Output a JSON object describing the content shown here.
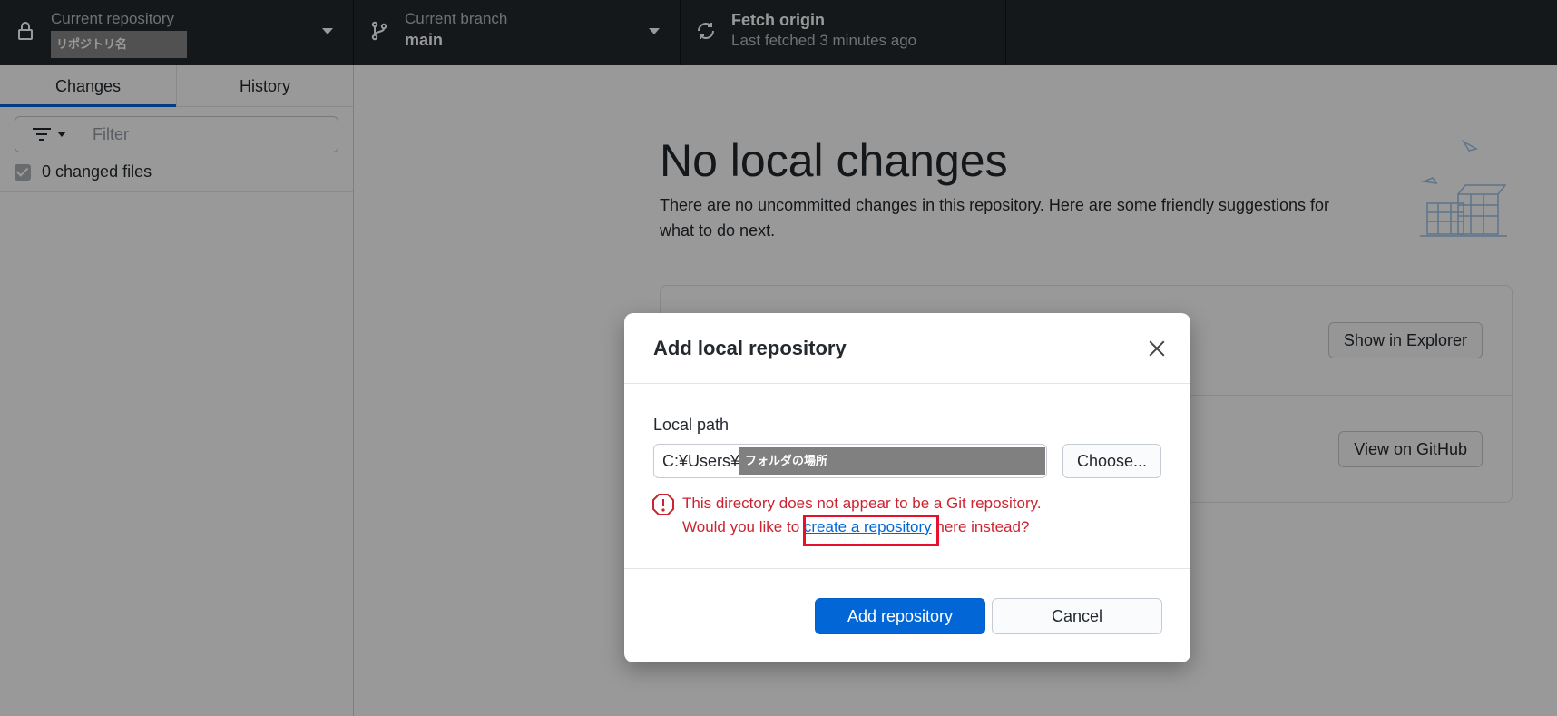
{
  "toolbar": {
    "repository": {
      "title": "Current repository",
      "value": "リポジトリ名",
      "icon": "lock-icon"
    },
    "branch": {
      "title": "Current branch",
      "value": "main",
      "icon": "git-branch-icon"
    },
    "fetch": {
      "title": "Fetch origin",
      "subtitle": "Last fetched 3 minutes ago",
      "icon": "sync-icon"
    }
  },
  "sidebar": {
    "tabs": [
      {
        "label": "Changes",
        "active": true
      },
      {
        "label": "History",
        "active": false
      }
    ],
    "filter": {
      "placeholder": "Filter"
    },
    "changed_files_label": "0 changed files"
  },
  "main": {
    "title": "No local changes",
    "description": "There are no uncommitted changes in this repository. Here are some friendly suggestions for what to do next.",
    "suggestions": {
      "show_in_explorer": "Show in Explorer",
      "view_on_github": "View on GitHub"
    }
  },
  "dialog": {
    "title": "Add local repository",
    "local_path_label": "Local path",
    "path_prefix": "C:¥Users¥",
    "path_redacted": "フォルダの場所",
    "choose_button": "Choose...",
    "error_line1": "This directory does not appear to be a Git repository.",
    "error_line2_before": "Would you like to ",
    "error_link": "create a repository",
    "error_line2_after": " here instead?",
    "add_button": "Add repository",
    "cancel_button": "Cancel"
  },
  "colors": {
    "toolbar_bg": "#24292e",
    "accent_blue": "#0366d6",
    "error_red": "#cb2431",
    "highlight_red": "#e8112d"
  }
}
